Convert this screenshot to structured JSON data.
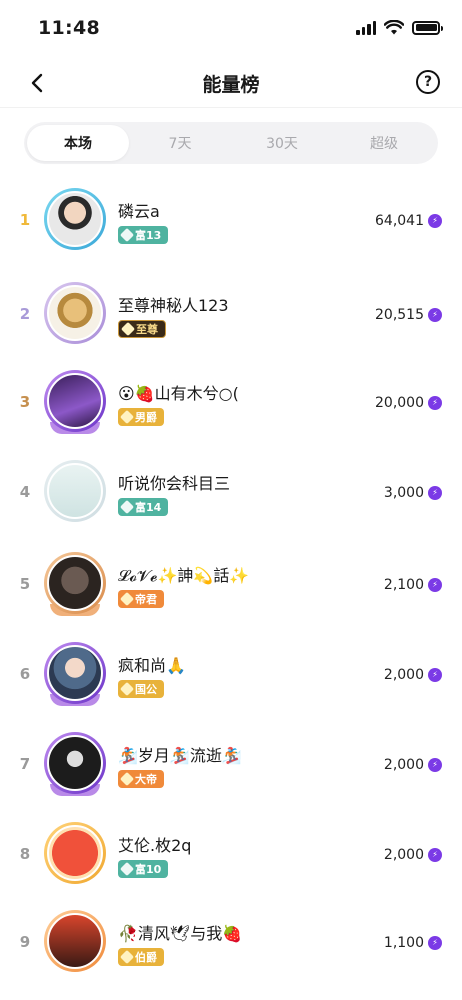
{
  "status": {
    "time": "11:48"
  },
  "nav": {
    "title": "能量榜",
    "help": "?"
  },
  "tabs": [
    {
      "label": "本场",
      "active": true
    },
    {
      "label": "7天",
      "active": false
    },
    {
      "label": "30天",
      "active": false
    },
    {
      "label": "超级",
      "active": false
    }
  ],
  "ranks": [
    {
      "rank": "1",
      "name": "磷云a",
      "badge": "富13",
      "score": "64,041"
    },
    {
      "rank": "2",
      "name": "至尊神秘人123",
      "badge": "至尊",
      "score": "20,515"
    },
    {
      "rank": "3",
      "name": "😮🍓山有木兮○(",
      "badge": "男爵",
      "score": "20,000"
    },
    {
      "rank": "4",
      "name": "听说你会科目三",
      "badge": "富14",
      "score": "3,000"
    },
    {
      "rank": "5",
      "name": "𝓛𝓸𝓥𝓮✨訷💫話✨",
      "badge": "帝君",
      "score": "2,100"
    },
    {
      "rank": "6",
      "name": "疯和尚🙏",
      "badge": "国公",
      "score": "2,000"
    },
    {
      "rank": "7",
      "name": "🏂岁月🏂流逝🏂",
      "badge": "大帝",
      "score": "2,000"
    },
    {
      "rank": "8",
      "name": "艾伦.枚2q",
      "badge": "富10",
      "score": "2,000"
    },
    {
      "rank": "9",
      "name": "🥀清风🕊与我🍓",
      "badge": "伯爵",
      "score": "1,100"
    }
  ],
  "colors": {
    "rank_1": "#f0b93a",
    "rank_2": "#a89ad8",
    "rank_3": "#c6904f",
    "rank_other": "#9a9a9a",
    "energy": "#7b3ae6",
    "badge_teal": "#4fb3a0",
    "badge_gold": "#e8b23a",
    "badge_orange": "#f08a3a",
    "badge_dark": "#3a2a18"
  },
  "icons": {
    "back": "chevron-left-icon",
    "help": "question-circle-icon",
    "energy": "energy-bolt-icon",
    "signal": "signal-icon",
    "wifi": "wifi-icon",
    "battery": "battery-icon"
  }
}
